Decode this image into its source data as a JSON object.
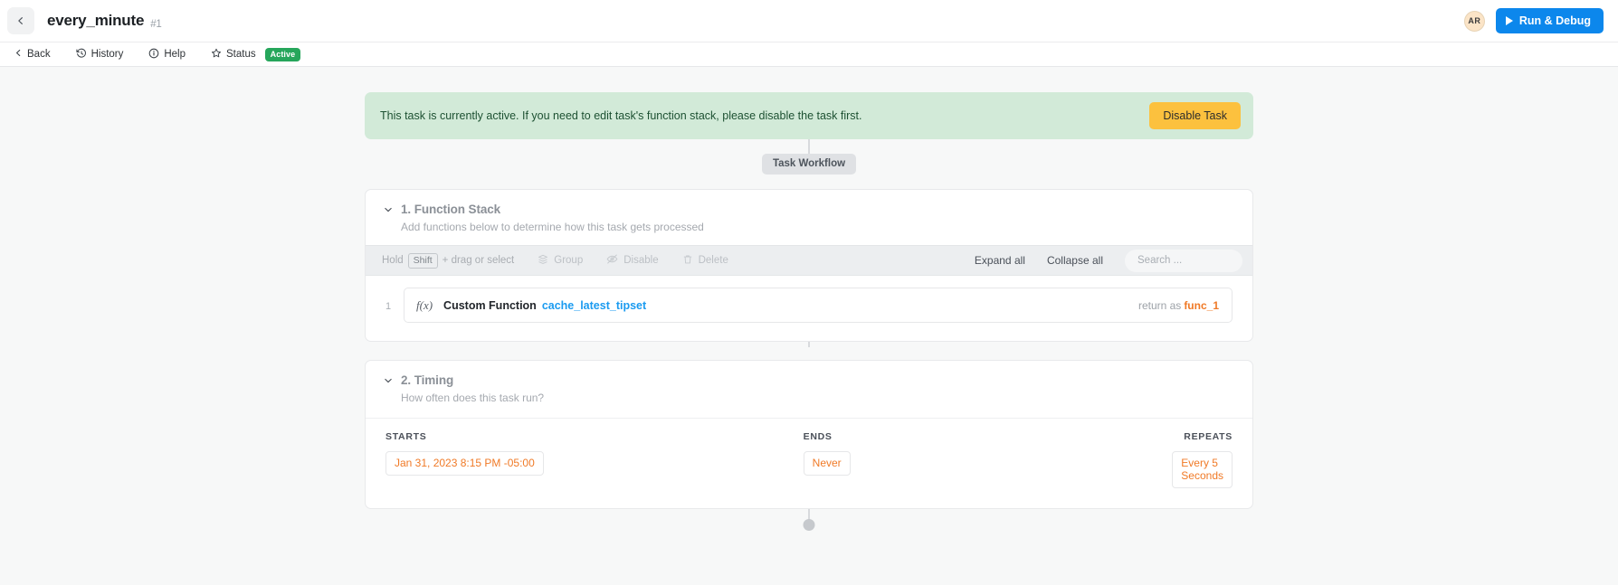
{
  "topbar": {
    "back_icon": "chevron-left-icon",
    "task_title": "every_minute",
    "task_id": "#1",
    "avatar_initials": "AR",
    "run_debug_label": "Run & Debug",
    "accent_blue": "#0c87ec"
  },
  "subnav": {
    "items": [
      {
        "label": "Back",
        "icon": "chevron-left-icon"
      },
      {
        "label": "History",
        "icon": "history-clock-icon"
      },
      {
        "label": "Help",
        "icon": "info-circle-icon"
      },
      {
        "label": "Status",
        "icon": "star-icon"
      }
    ],
    "status_badge": "Active",
    "status_badge_color": "#26a65b"
  },
  "banner": {
    "message": "This task is currently active. If you need to edit task's function stack, please disable the task first.",
    "button_label": "Disable Task",
    "background": "#d2ead8",
    "button_color": "#fcc13e"
  },
  "workflow_pill": {
    "label": "Task Workflow"
  },
  "function_stack": {
    "title": "1. Function Stack",
    "subtitle": "Add functions below to determine how this task gets processed",
    "toolbar": {
      "hold_prefix": "Hold",
      "key_label": "Shift",
      "hold_suffix": "+ drag or select",
      "group_label": "Group",
      "disable_label": "Disable",
      "delete_label": "Delete",
      "expand_all_label": "Expand all",
      "collapse_all_label": "Collapse all",
      "search_placeholder": "Search ..."
    },
    "rows": [
      {
        "index": "1",
        "icon": "fx-icon",
        "type_label": "Custom Function",
        "function_name": "cache_latest_tipset",
        "return_prefix": "return as",
        "return_var": "func_1",
        "name_color": "#1b9bf0",
        "var_color": "#f07a27"
      }
    ]
  },
  "timing": {
    "title": "2. Timing",
    "subtitle": "How often does this task run?",
    "starts_label": "STARTS",
    "starts_value": "Jan 31, 2023 8:15 PM -05:00",
    "ends_label": "ENDS",
    "ends_value": "Never",
    "repeats_label": "REPEATS",
    "repeats_value": "Every 5 Seconds"
  }
}
